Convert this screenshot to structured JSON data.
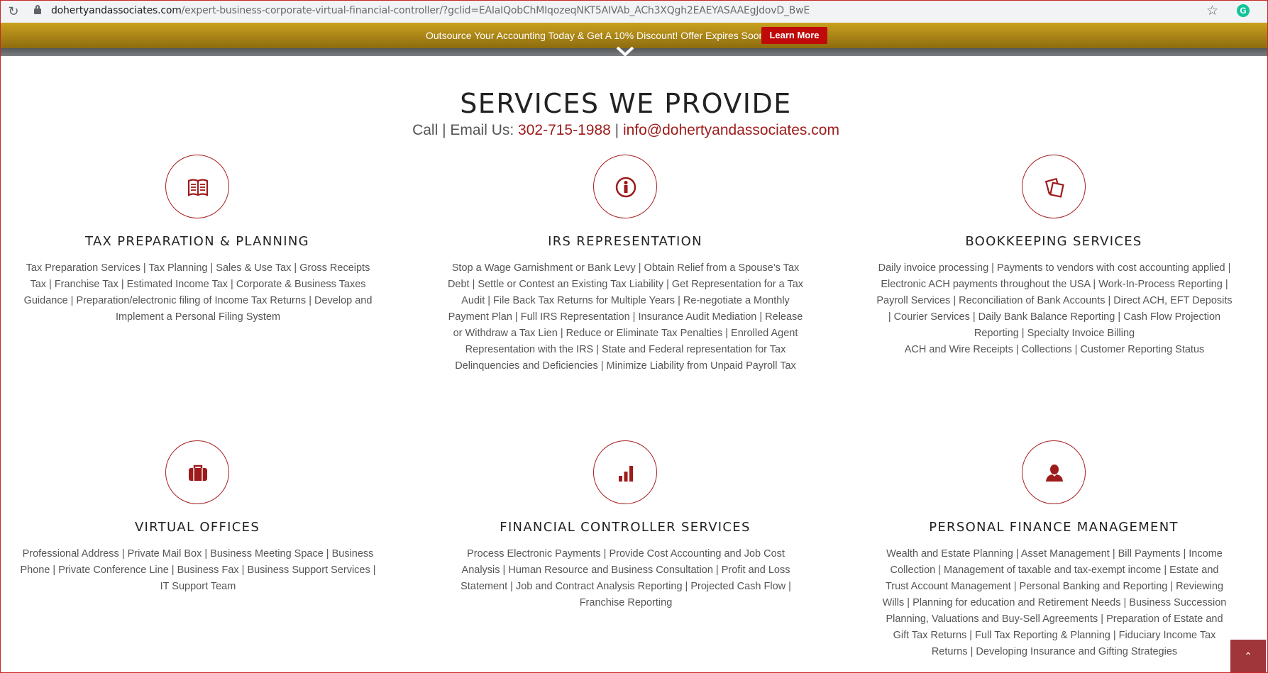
{
  "browser": {
    "domain": "dohertyandassociates.com",
    "path": "/expert-business-corporate-virtual-financial-controller/?gclid=EAIaIQobChMIqozeqNKT5AIVAb_ACh3XQgh2EAEYASAAEgJdovD_BwE"
  },
  "promo": {
    "text": "Outsource Your Accounting Today & Get A 10% Discount! Offer Expires Soon.",
    "button": "Learn More"
  },
  "section": {
    "title": "SERVICES WE PROVIDE",
    "contact_prefix": "Call | Email Us: ",
    "phone": "302-715-1988",
    "separator": " | ",
    "email": "info@dohertyandassociates.com"
  },
  "services": [
    {
      "icon": "book-icon",
      "title": "TAX PREPARATION & PLANNING",
      "description": "Tax Preparation Services | Tax Planning | Sales & Use Tax | Gross Receipts Tax | Franchise Tax | Estimated Income Tax | Corporate & Business Taxes Guidance | Preparation/electronic filing of Income Tax Returns | Develop and Implement a Personal Filing System"
    },
    {
      "icon": "info-icon",
      "title": "IRS REPRESENTATION",
      "description": "Stop a Wage Garnishment or Bank Levy | Obtain Relief from a Spouse’s Tax Debt | Settle or Contest an Existing Tax Liability | Get Representation for a Tax Audit | File Back Tax Returns for Multiple Years | Re-negotiate a Monthly Payment Plan | Full IRS Representation | Insurance Audit Mediation | Release or Withdraw a Tax Lien | Reduce or Eliminate Tax Penalties | Enrolled Agent Representation with the IRS | State and Federal representation for Tax Delinquencies and Deficiencies | Minimize Liability from Unpaid Payroll Tax"
    },
    {
      "icon": "documents-icon",
      "title": "BOOKKEEPING SERVICES",
      "description": "Daily invoice processing | Payments to vendors with cost accounting applied | Electronic ACH payments throughout the USA | Work-In-Process Reporting | Payroll Services | Reconciliation of Bank Accounts | Direct ACH, EFT Deposits | Courier Services | Daily Bank Balance Reporting | Cash Flow Projection Reporting | Specialty Invoice Billing",
      "description_2": "ACH and Wire Receipts | Collections | Customer Reporting Status"
    },
    {
      "icon": "briefcase-icon",
      "title": "VIRTUAL OFFICES",
      "description": "Professional Address | Private Mail Box | Business Meeting Space | Business Phone | Private Conference Line | Business Fax | Business Support Services | IT Support Team"
    },
    {
      "icon": "bar-chart-icon",
      "title": "FINANCIAL CONTROLLER SERVICES",
      "description": "Process Electronic Payments | Provide Cost Accounting and Job Cost Analysis | Human Resource and Business Consultation | Profit and Loss Statement | Job and Contract Analysis Reporting | Projected Cash Flow | Franchise Reporting"
    },
    {
      "icon": "person-icon",
      "title": "PERSONAL FINANCE MANAGEMENT",
      "description": "Wealth and Estate Planning | Asset Management | Bill Payments | Income Collection | Management of taxable and tax-exempt income | Estate and Trust Account Management | Personal Banking and Reporting | Reviewing Wills | Planning for education and Retirement Needs | Business Succession Planning, Valuations and Buy-Sell Agreements | Preparation of Estate and Gift Tax Returns | Full Tax Reporting & Planning | Fiduciary Income Tax Returns | Developing Insurance and Gifting Strategies"
    }
  ],
  "colors": {
    "accent": "#9e1b1b",
    "promo_gold": "#b08a18",
    "button_red": "#c00a0a"
  }
}
